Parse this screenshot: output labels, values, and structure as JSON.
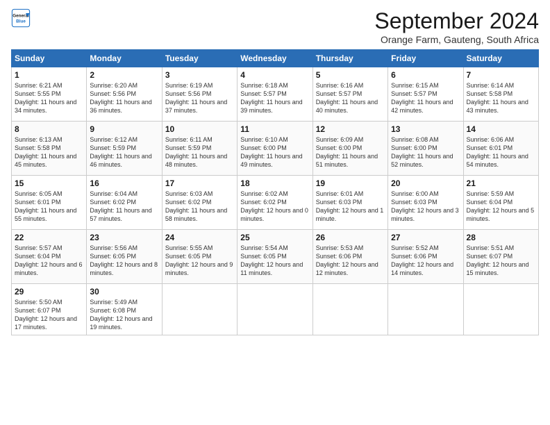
{
  "header": {
    "logo_line1": "General",
    "logo_line2": "Blue",
    "month": "September 2024",
    "location": "Orange Farm, Gauteng, South Africa"
  },
  "weekdays": [
    "Sunday",
    "Monday",
    "Tuesday",
    "Wednesday",
    "Thursday",
    "Friday",
    "Saturday"
  ],
  "weeks": [
    [
      {
        "day": "1",
        "sunrise": "Sunrise: 6:21 AM",
        "sunset": "Sunset: 5:55 PM",
        "daylight": "Daylight: 11 hours and 34 minutes."
      },
      {
        "day": "2",
        "sunrise": "Sunrise: 6:20 AM",
        "sunset": "Sunset: 5:56 PM",
        "daylight": "Daylight: 11 hours and 36 minutes."
      },
      {
        "day": "3",
        "sunrise": "Sunrise: 6:19 AM",
        "sunset": "Sunset: 5:56 PM",
        "daylight": "Daylight: 11 hours and 37 minutes."
      },
      {
        "day": "4",
        "sunrise": "Sunrise: 6:18 AM",
        "sunset": "Sunset: 5:57 PM",
        "daylight": "Daylight: 11 hours and 39 minutes."
      },
      {
        "day": "5",
        "sunrise": "Sunrise: 6:16 AM",
        "sunset": "Sunset: 5:57 PM",
        "daylight": "Daylight: 11 hours and 40 minutes."
      },
      {
        "day": "6",
        "sunrise": "Sunrise: 6:15 AM",
        "sunset": "Sunset: 5:57 PM",
        "daylight": "Daylight: 11 hours and 42 minutes."
      },
      {
        "day": "7",
        "sunrise": "Sunrise: 6:14 AM",
        "sunset": "Sunset: 5:58 PM",
        "daylight": "Daylight: 11 hours and 43 minutes."
      }
    ],
    [
      {
        "day": "8",
        "sunrise": "Sunrise: 6:13 AM",
        "sunset": "Sunset: 5:58 PM",
        "daylight": "Daylight: 11 hours and 45 minutes."
      },
      {
        "day": "9",
        "sunrise": "Sunrise: 6:12 AM",
        "sunset": "Sunset: 5:59 PM",
        "daylight": "Daylight: 11 hours and 46 minutes."
      },
      {
        "day": "10",
        "sunrise": "Sunrise: 6:11 AM",
        "sunset": "Sunset: 5:59 PM",
        "daylight": "Daylight: 11 hours and 48 minutes."
      },
      {
        "day": "11",
        "sunrise": "Sunrise: 6:10 AM",
        "sunset": "Sunset: 6:00 PM",
        "daylight": "Daylight: 11 hours and 49 minutes."
      },
      {
        "day": "12",
        "sunrise": "Sunrise: 6:09 AM",
        "sunset": "Sunset: 6:00 PM",
        "daylight": "Daylight: 11 hours and 51 minutes."
      },
      {
        "day": "13",
        "sunrise": "Sunrise: 6:08 AM",
        "sunset": "Sunset: 6:00 PM",
        "daylight": "Daylight: 11 hours and 52 minutes."
      },
      {
        "day": "14",
        "sunrise": "Sunrise: 6:06 AM",
        "sunset": "Sunset: 6:01 PM",
        "daylight": "Daylight: 11 hours and 54 minutes."
      }
    ],
    [
      {
        "day": "15",
        "sunrise": "Sunrise: 6:05 AM",
        "sunset": "Sunset: 6:01 PM",
        "daylight": "Daylight: 11 hours and 55 minutes."
      },
      {
        "day": "16",
        "sunrise": "Sunrise: 6:04 AM",
        "sunset": "Sunset: 6:02 PM",
        "daylight": "Daylight: 11 hours and 57 minutes."
      },
      {
        "day": "17",
        "sunrise": "Sunrise: 6:03 AM",
        "sunset": "Sunset: 6:02 PM",
        "daylight": "Daylight: 11 hours and 58 minutes."
      },
      {
        "day": "18",
        "sunrise": "Sunrise: 6:02 AM",
        "sunset": "Sunset: 6:02 PM",
        "daylight": "Daylight: 12 hours and 0 minutes."
      },
      {
        "day": "19",
        "sunrise": "Sunrise: 6:01 AM",
        "sunset": "Sunset: 6:03 PM",
        "daylight": "Daylight: 12 hours and 1 minute."
      },
      {
        "day": "20",
        "sunrise": "Sunrise: 6:00 AM",
        "sunset": "Sunset: 6:03 PM",
        "daylight": "Daylight: 12 hours and 3 minutes."
      },
      {
        "day": "21",
        "sunrise": "Sunrise: 5:59 AM",
        "sunset": "Sunset: 6:04 PM",
        "daylight": "Daylight: 12 hours and 5 minutes."
      }
    ],
    [
      {
        "day": "22",
        "sunrise": "Sunrise: 5:57 AM",
        "sunset": "Sunset: 6:04 PM",
        "daylight": "Daylight: 12 hours and 6 minutes."
      },
      {
        "day": "23",
        "sunrise": "Sunrise: 5:56 AM",
        "sunset": "Sunset: 6:05 PM",
        "daylight": "Daylight: 12 hours and 8 minutes."
      },
      {
        "day": "24",
        "sunrise": "Sunrise: 5:55 AM",
        "sunset": "Sunset: 6:05 PM",
        "daylight": "Daylight: 12 hours and 9 minutes."
      },
      {
        "day": "25",
        "sunrise": "Sunrise: 5:54 AM",
        "sunset": "Sunset: 6:05 PM",
        "daylight": "Daylight: 12 hours and 11 minutes."
      },
      {
        "day": "26",
        "sunrise": "Sunrise: 5:53 AM",
        "sunset": "Sunset: 6:06 PM",
        "daylight": "Daylight: 12 hours and 12 minutes."
      },
      {
        "day": "27",
        "sunrise": "Sunrise: 5:52 AM",
        "sunset": "Sunset: 6:06 PM",
        "daylight": "Daylight: 12 hours and 14 minutes."
      },
      {
        "day": "28",
        "sunrise": "Sunrise: 5:51 AM",
        "sunset": "Sunset: 6:07 PM",
        "daylight": "Daylight: 12 hours and 15 minutes."
      }
    ],
    [
      {
        "day": "29",
        "sunrise": "Sunrise: 5:50 AM",
        "sunset": "Sunset: 6:07 PM",
        "daylight": "Daylight: 12 hours and 17 minutes."
      },
      {
        "day": "30",
        "sunrise": "Sunrise: 5:49 AM",
        "sunset": "Sunset: 6:08 PM",
        "daylight": "Daylight: 12 hours and 19 minutes."
      },
      null,
      null,
      null,
      null,
      null
    ]
  ]
}
